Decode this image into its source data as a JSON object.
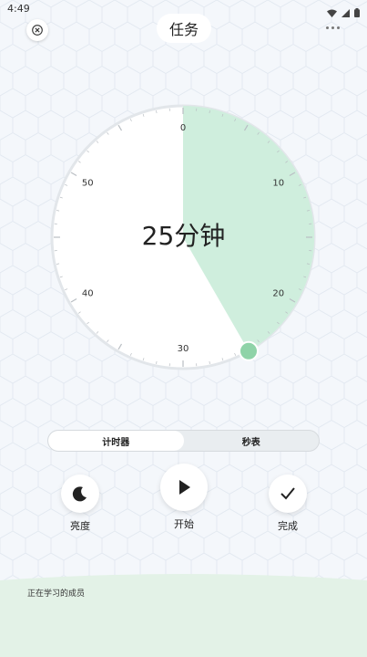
{
  "status_bar": {
    "time": "4:49",
    "icons": [
      "wifi-icon",
      "signal-icon",
      "battery-icon"
    ]
  },
  "header": {
    "title": "任务",
    "close_icon": "close-icon",
    "more_icon": "more-icon"
  },
  "dial": {
    "center_text": "25分钟",
    "minutes_selected": 25,
    "max_minutes": 60,
    "tick_labels": [
      "0",
      "10",
      "20",
      "30",
      "40",
      "50"
    ],
    "accent_color": "#cfeedd",
    "handle_color": "#8fd3a8"
  },
  "mode_toggle": {
    "timer_label": "计时器",
    "stopwatch_label": "秒表",
    "active": "timer"
  },
  "controls": {
    "brightness_label": "亮度",
    "start_label": "开始",
    "done_label": "完成"
  },
  "footer": {
    "members_label": "正在学习的成员"
  }
}
